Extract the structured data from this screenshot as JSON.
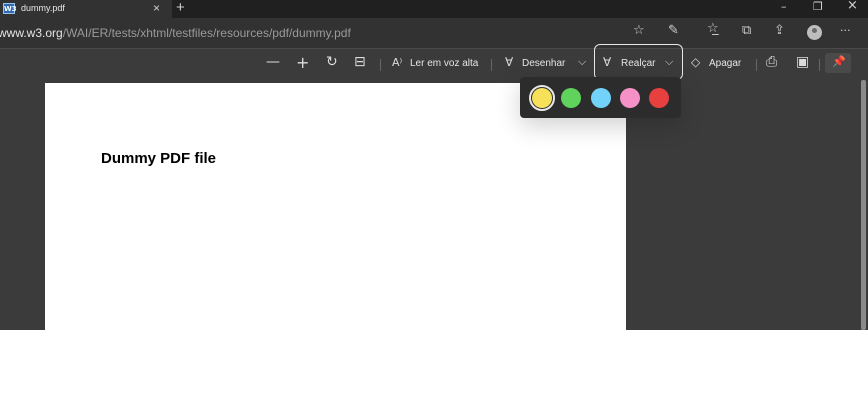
{
  "tab": {
    "favicon_text": "W3",
    "title": "dummy.pdf",
    "close": "×",
    "new_tab": "+"
  },
  "window": {
    "minimize": "–",
    "restore": "❐",
    "close": "×"
  },
  "address": {
    "host": "www.w3.org",
    "path": "/WAI/ER/tests/xhtml/testfiles/resources/pdf/dummy.pdf"
  },
  "addr_icons": {
    "favorite": "☆",
    "read_aloud": "✎",
    "favorites_list": "☆̲",
    "collections": "⧉",
    "share": "⇪",
    "more": "···"
  },
  "toolbar": {
    "zoom_out": "—",
    "zoom_in": "+",
    "rotate": "↻",
    "fit": "⊟",
    "read_aloud_icon": "A⁾",
    "read_aloud_label": "Ler em voz alta",
    "draw_icon": "∀",
    "draw_label": "Desenhar",
    "draw_chevron": "⌵",
    "highlight_icon": "∀",
    "highlight_label": "Realçar",
    "highlight_chevron": "⌵",
    "erase_icon": "◇",
    "erase_label": "Apagar",
    "print": "⎙",
    "save": "▣",
    "pin": "📌"
  },
  "document": {
    "title": "Dummy PDF file"
  },
  "highlight_colors": [
    {
      "name": "yellow",
      "hex": "#f7e15a",
      "selected": true
    },
    {
      "name": "green",
      "hex": "#5fd35c",
      "selected": false
    },
    {
      "name": "light-blue",
      "hex": "#73d2fa",
      "selected": false
    },
    {
      "name": "pink",
      "hex": "#f591c6",
      "selected": false
    },
    {
      "name": "red",
      "hex": "#e8403f",
      "selected": false
    }
  ]
}
